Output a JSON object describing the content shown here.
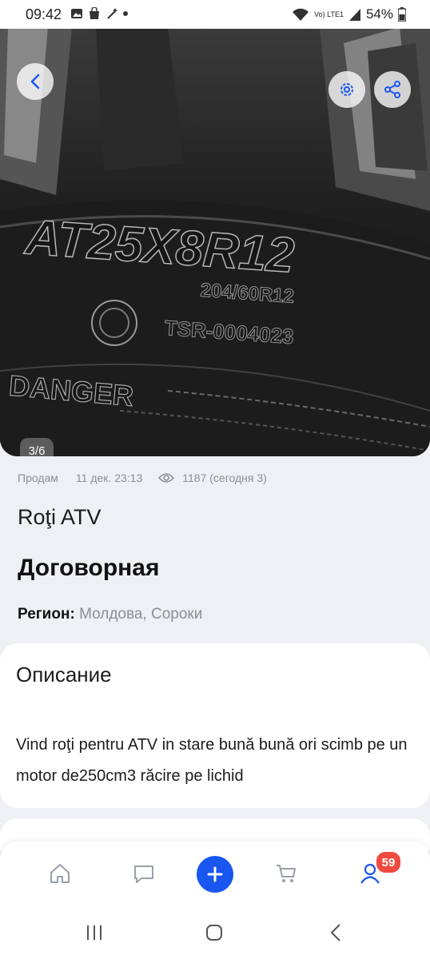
{
  "status_bar": {
    "time": "09:42",
    "battery": "54%",
    "network": "Vo) LTE1",
    "icons_left": [
      "gallery-icon",
      "bag-icon",
      "wand-icon",
      "dot-icon"
    ]
  },
  "gallery": {
    "counter": "3/6",
    "photo_text": {
      "line1": "AT25X8R12",
      "line2": "204/60R12",
      "line3": "TSR-0004023",
      "line4": "DANGER"
    }
  },
  "listing": {
    "type": "Продам",
    "date": "11 дек. 23:13",
    "views": "1187 (сегодня 3)",
    "title": "Roţi ATV",
    "price": "Договорная",
    "region_label": "Регион:",
    "region_value": "Молдова, Сороки"
  },
  "description": {
    "heading": "Описание",
    "text": "Vind roţi pentru ATV in stare bună bună ori scimb pe un motor de250cm3 răcire pe lichid"
  },
  "bottom_nav": {
    "items": [
      "home",
      "messages",
      "add",
      "cart",
      "profile"
    ],
    "notification_count": "59"
  },
  "colors": {
    "accent": "#1a56f0",
    "badge": "#ef4a3e",
    "muted": "#8a8f98"
  }
}
